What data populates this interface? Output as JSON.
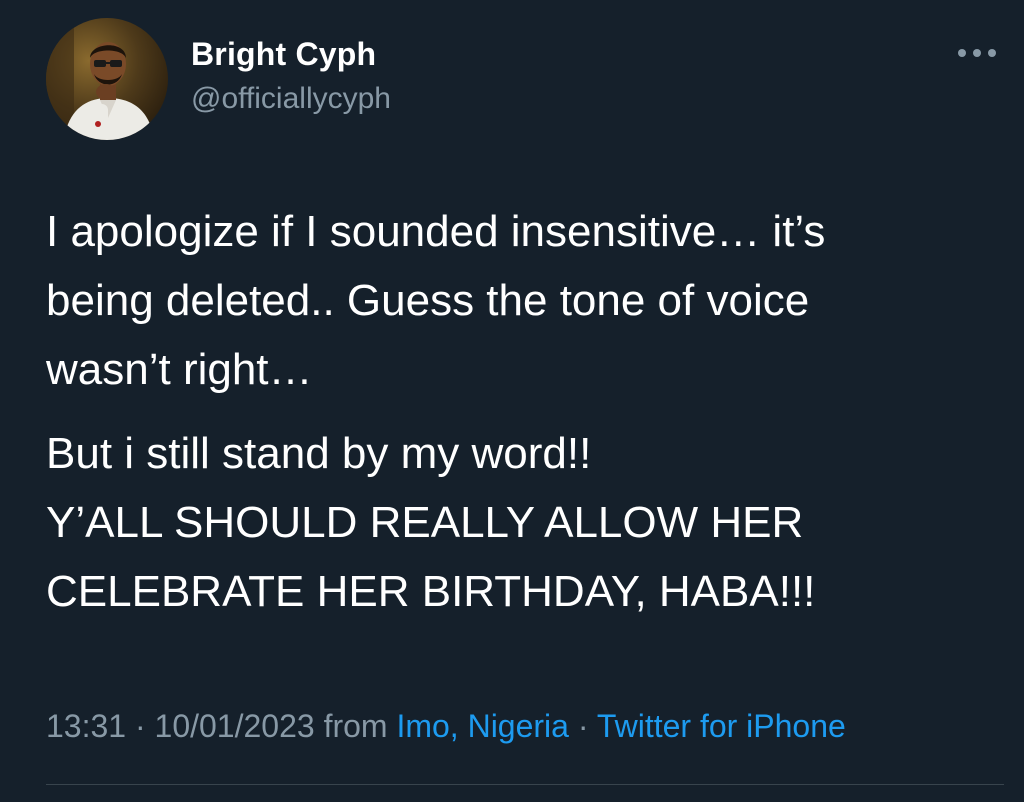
{
  "author": {
    "name": "Bright Cyph",
    "handle": "@officiallycyph"
  },
  "avatar_icon": "user-avatar-photo",
  "more_icon": "more-options-icon",
  "tweet": {
    "paragraphs": [
      {
        "lines": [
          "I apologize if I sounded insensitive… it’s",
          "being deleted.. Guess the tone of voice",
          "wasn’t right…"
        ]
      },
      {
        "lines": [
          "But i still stand by my word!!",
          "Y’ALL SHOULD REALLY ALLOW HER",
          "CELEBRATE HER BIRTHDAY, HABA!!!"
        ]
      }
    ]
  },
  "meta": {
    "time": "13:31",
    "separator": "·",
    "date": "10/01/2023",
    "from_label": "from",
    "location": "Imo, Nigeria",
    "source": "Twitter for iPhone"
  },
  "colors": {
    "background": "#15202b",
    "text": "#ffffff",
    "secondary": "#8899a6",
    "link": "#1d9bf0",
    "divider": "#38444d"
  }
}
